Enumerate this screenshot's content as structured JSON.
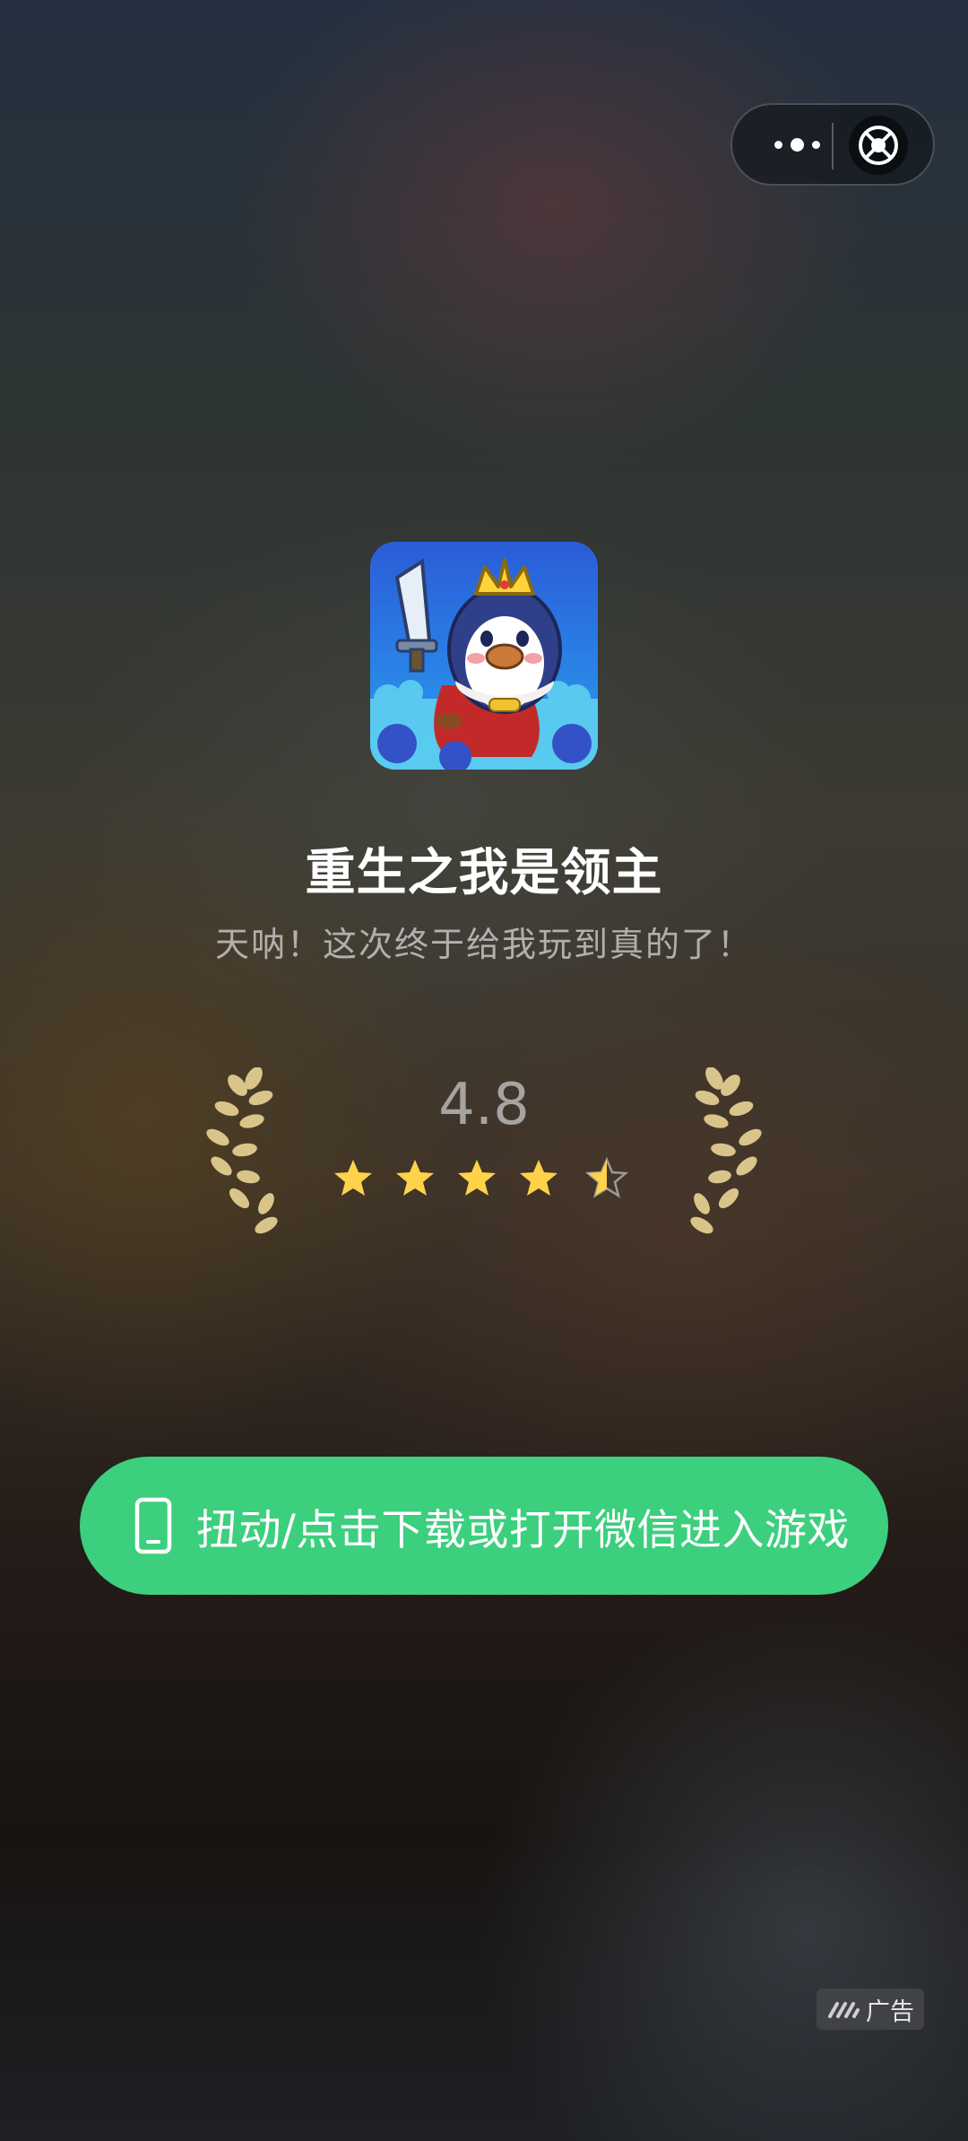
{
  "capsule": {
    "more_icon": "more-dots-icon",
    "close_icon": "exit-target-icon"
  },
  "game": {
    "icon": "penguin-king-app-icon",
    "title": "重生之我是领主",
    "subtitle": "天呐！这次终于给我玩到真的了！"
  },
  "rating": {
    "value": "4.8",
    "stars_filled": 4.5,
    "stars_total": 5,
    "star_color": "#ffd24a"
  },
  "cta": {
    "icon": "phone-icon",
    "label": "扭动/点击下载或打开微信进入游戏",
    "color": "#3ccf7e"
  },
  "ad_badge": {
    "icon": "ad-logo-icon",
    "label": "广告"
  }
}
